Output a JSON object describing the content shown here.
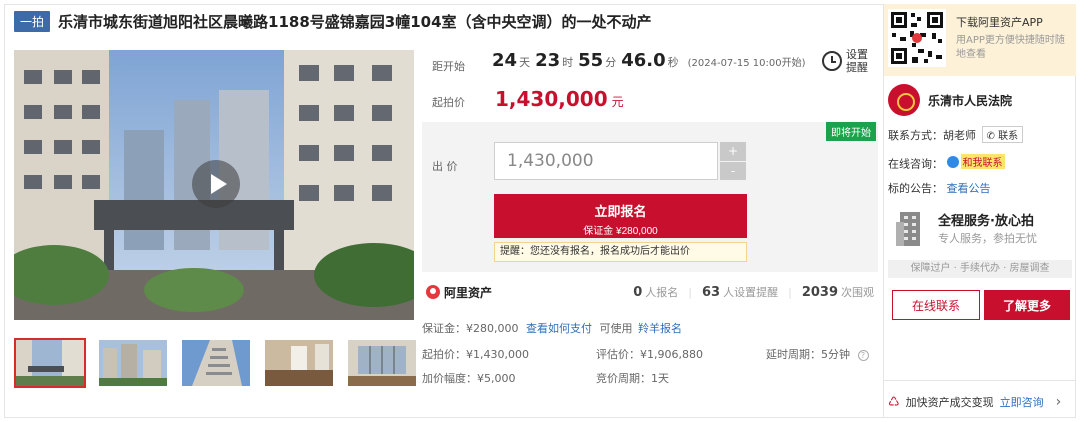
{
  "header": {
    "tag": "一拍",
    "title": "乐清市城东街道旭阳社区晨曦路1188号盛锦嘉园3幢104室（含中央空调）的一处不动产"
  },
  "gallery": {
    "thumb_count": 5
  },
  "countdown": {
    "label": "距开始",
    "days": "24",
    "days_unit": "天",
    "hours": "23",
    "hours_unit": "时",
    "minutes": "55",
    "minutes_unit": "分",
    "seconds": "46.0",
    "seconds_unit": "秒",
    "start_time": "(2024-07-15 10:00开始)",
    "reminder_label": "设置提醒"
  },
  "start_price": {
    "label": "起拍价",
    "value": "1,430,000",
    "unit": "元"
  },
  "bid": {
    "badge": "即将开始",
    "label": "出  价",
    "input_value": "1,430,000",
    "plus": "+",
    "minus": "-",
    "register_label": "立即报名",
    "deposit_label": "保证金 ¥280,000",
    "tip": "提醒：您还没有报名，报名成功后才能出价"
  },
  "stats": {
    "brand": "阿里资产",
    "registered_count": "0",
    "registered_label": "人报名",
    "reminder_count": "63",
    "reminder_label": "人设置提醒",
    "views_count": "2039",
    "views_label": "次围观"
  },
  "info": {
    "deposit": "保证金：¥280,000",
    "how_to_pay": "查看如何支付",
    "usable": "可使用",
    "guarantee_link": "羚羊报名",
    "start_price": "起拍价：¥1,430,000",
    "appraisal": "评估价：¥1,906,880",
    "delay": "延时周期：5分钟",
    "increment": "加价幅度：¥5,000",
    "cycle": "竞价周期：1天"
  },
  "sidebar": {
    "app_title": "下载阿里资产APP",
    "app_desc": "用APP更方便快捷随时随地查看",
    "court_name": "乐清市人民法院",
    "contact_label": "联系方式：胡老师",
    "contact_button": "联系",
    "online_label": "在线咨询：",
    "online_chat": "和我联系",
    "notice_label": "标的公告：",
    "notice_link": "查看公告",
    "service_title": "全程服务·放心拍",
    "service_sub": "专人服务，参拍无忧",
    "service_bar": "保障过户 · 手续代办 · 房屋调查",
    "online_contact_btn": "在线联系",
    "learn_more_btn": "了解更多",
    "bottom_text": "加快资产成交变现",
    "bottom_link": "立即咨询",
    "bottom_arrow": "›"
  },
  "colors": {
    "accent_red": "#c8102e",
    "tag_blue": "#3d6aa8",
    "badge_green": "#1aa34a",
    "link_blue": "#2f6fba",
    "app_bg": "#fdf2d8"
  },
  "icons": [
    "play-icon",
    "alarm-clock-icon",
    "aliyun-logo-icon",
    "qr-code-icon",
    "court-seal-icon",
    "chat-icon",
    "building-icon",
    "phone-icon",
    "chevron-right-icon"
  ]
}
